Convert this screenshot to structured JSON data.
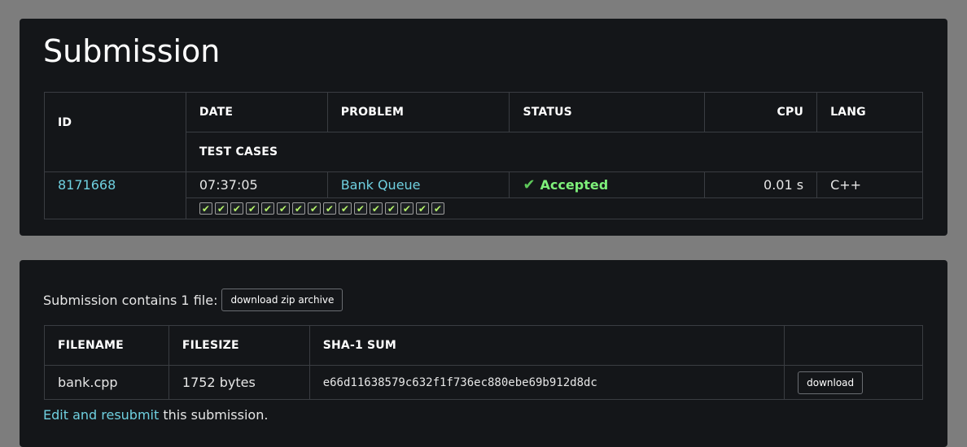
{
  "page": {
    "title": "Submission"
  },
  "submission_table": {
    "headers": {
      "id": "ID",
      "date": "DATE",
      "problem": "PROBLEM",
      "status": "STATUS",
      "cpu": "CPU",
      "lang": "LANG",
      "test_cases": "TEST CASES"
    },
    "row": {
      "id": "8171668",
      "date": "07:37:05",
      "problem": "Bank Queue",
      "status": "Accepted",
      "cpu": "0.01 s",
      "lang": "C++"
    },
    "test_cases": {
      "count": 16,
      "result": "accepted",
      "icon": "check-icon"
    }
  },
  "files_section": {
    "summary": "Submission contains 1 file:",
    "zip_button": "download zip archive",
    "headers": {
      "filename": "FILENAME",
      "filesize": "FILESIZE",
      "sha1": "SHA-1 SUM"
    },
    "files": [
      {
        "filename": "bank.cpp",
        "filesize": "1752 bytes",
        "sha1": "e66d11638579c632f1f736ec880ebe69b912d8dc",
        "download": "download"
      }
    ],
    "resubmit_link": "Edit and resubmit",
    "resubmit_suffix": " this submission."
  },
  "colors": {
    "accent_link": "#6fd0e0",
    "accepted": "#7ef07a",
    "panel_bg": "#141619",
    "page_bg": "#7d7d7d"
  }
}
